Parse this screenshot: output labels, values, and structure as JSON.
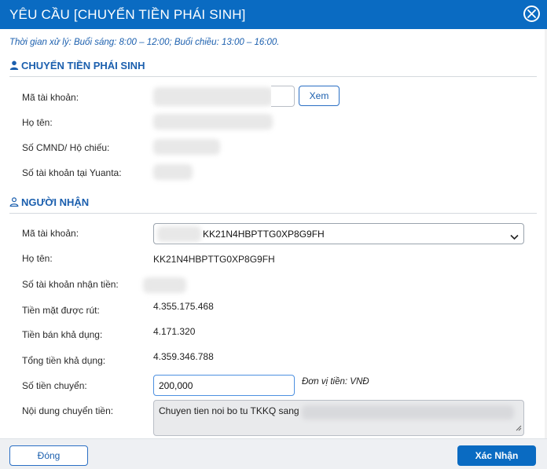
{
  "dialog": {
    "title": "YÊU CẦU [CHUYỂN TIỀN PHÁI SINH]",
    "hours_note": "Thời gian xử lý: Buổi sáng: 8:00 – 12:00; Buổi chiều: 13:00 – 16:00.",
    "close_icon": "close-circle-icon"
  },
  "sender": {
    "section_title": "CHUYỂN TIỀN PHÁI SINH",
    "section_icon": "user-solid-icon",
    "account_label": "Mã tài khoản:",
    "view_button": "Xem",
    "name_label": "Họ tên:",
    "id_label": "Số CMND/ Hộ chiếu:",
    "yuanta_account_label": "Số tài khoản tại Yuanta:"
  },
  "receiver": {
    "section_title": "NGƯỜI NHẬN",
    "section_icon": "user-outline-icon",
    "account_label": "Mã tài khoản:",
    "account_selected": "KK21N4HBPTTG0XP8G9FH",
    "name_label": "Họ tên:",
    "name_value": "KK21N4HBPTTG0XP8G9FH",
    "receive_account_label": "Số tài khoản nhận tiền:",
    "cash_withdrawable_label": "Tiền mặt được rút:",
    "cash_withdrawable_value": "4.355.175.468",
    "sell_available_label": "Tiền bán khả dụng:",
    "sell_available_value": "4.171.320",
    "total_available_label": "Tổng tiền khả dụng:",
    "total_available_value": "4.359.346.788",
    "amount_label": "Số tiền chuyển:",
    "amount_value": "200,000",
    "unit_note": "Đơn vị tiền: VNĐ",
    "content_label": "Nội dung chuyển tiền:",
    "content_value": "Chuyen tien noi bo tu TKKQ sang"
  },
  "footer": {
    "close_button": "Đóng",
    "confirm_button": "Xác Nhận"
  },
  "colors": {
    "header_bg": "#0a6bc2",
    "accent_text": "#1b5fae",
    "footer_bg": "#eef0f3"
  }
}
